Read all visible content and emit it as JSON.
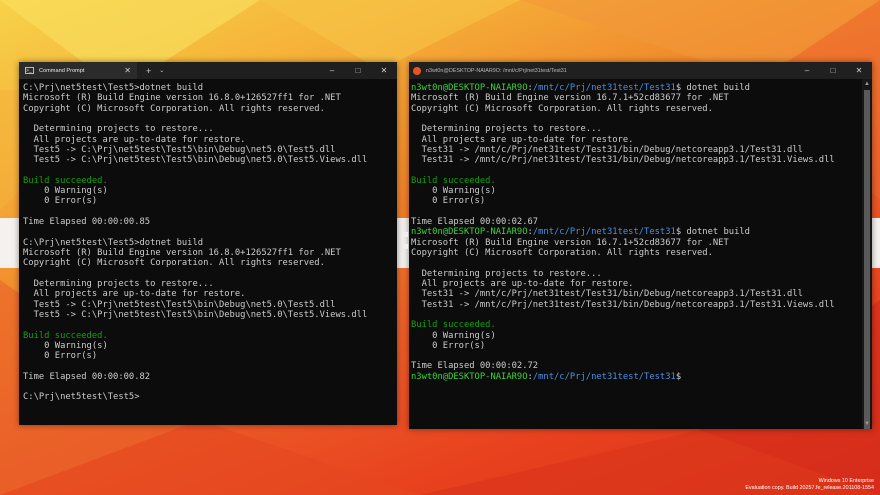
{
  "desktop": {
    "watermark": [
      "Windows 10 Enterprise",
      "Evaluation copy. Build 20257.fe_release.201108-1554"
    ]
  },
  "cmd_window": {
    "tab_title": "Command Prompt",
    "controls": [
      "–",
      "□",
      "✕"
    ],
    "lines": [
      [
        {
          "t": "C:\\Prj\\net5test\\Test5>dotnet build"
        }
      ],
      [
        {
          "t": "Microsoft (R) Build Engine version 16.8.0+126527ff1 for .NET"
        }
      ],
      [
        {
          "t": "Copyright (C) Microsoft Corporation. All rights reserved."
        }
      ],
      [
        {
          "t": ""
        }
      ],
      [
        {
          "t": "  Determining projects to restore..."
        }
      ],
      [
        {
          "t": "  All projects are up-to-date for restore."
        }
      ],
      [
        {
          "t": "  Test5 -> C:\\Prj\\net5test\\Test5\\bin\\Debug\\net5.0\\Test5.dll"
        }
      ],
      [
        {
          "t": "  Test5 -> C:\\Prj\\net5test\\Test5\\bin\\Debug\\net5.0\\Test5.Views.dll"
        }
      ],
      [
        {
          "t": ""
        }
      ],
      [
        {
          "t": "Build succeeded.",
          "c": "g"
        }
      ],
      [
        {
          "t": "    0 Warning(s)"
        }
      ],
      [
        {
          "t": "    0 Error(s)"
        }
      ],
      [
        {
          "t": ""
        }
      ],
      [
        {
          "t": "Time Elapsed 00:00:00.85"
        }
      ],
      [
        {
          "t": ""
        }
      ],
      [
        {
          "t": "C:\\Prj\\net5test\\Test5>dotnet build"
        }
      ],
      [
        {
          "t": "Microsoft (R) Build Engine version 16.8.0+126527ff1 for .NET"
        }
      ],
      [
        {
          "t": "Copyright (C) Microsoft Corporation. All rights reserved."
        }
      ],
      [
        {
          "t": ""
        }
      ],
      [
        {
          "t": "  Determining projects to restore..."
        }
      ],
      [
        {
          "t": "  All projects are up-to-date for restore."
        }
      ],
      [
        {
          "t": "  Test5 -> C:\\Prj\\net5test\\Test5\\bin\\Debug\\net5.0\\Test5.dll"
        }
      ],
      [
        {
          "t": "  Test5 -> C:\\Prj\\net5test\\Test5\\bin\\Debug\\net5.0\\Test5.Views.dll"
        }
      ],
      [
        {
          "t": ""
        }
      ],
      [
        {
          "t": "Build succeeded.",
          "c": "g"
        }
      ],
      [
        {
          "t": "    0 Warning(s)"
        }
      ],
      [
        {
          "t": "    0 Error(s)"
        }
      ],
      [
        {
          "t": ""
        }
      ],
      [
        {
          "t": "Time Elapsed 00:00:00.82"
        }
      ],
      [
        {
          "t": ""
        }
      ],
      [
        {
          "t": "C:\\Prj\\net5test\\Test5>"
        }
      ]
    ]
  },
  "wsl_window": {
    "title": "n3wt0n@DESKTOP-NAIAR9O: /mnt/c/Prj/net31test/Test31",
    "controls": [
      "–",
      "□",
      "✕"
    ],
    "lines": [
      [
        {
          "t": "n3wt0n@DESKTOP-NAIAR9O",
          "c": "bg"
        },
        {
          "t": ":"
        },
        {
          "t": "/mnt/c/Prj/net31test/Test31",
          "c": "bl"
        },
        {
          "t": "$ dotnet build"
        }
      ],
      [
        {
          "t": "Microsoft (R) Build Engine version 16.7.1+52cd83677 for .NET"
        }
      ],
      [
        {
          "t": "Copyright (C) Microsoft Corporation. All rights reserved."
        }
      ],
      [
        {
          "t": ""
        }
      ],
      [
        {
          "t": "  Determining projects to restore..."
        }
      ],
      [
        {
          "t": "  All projects are up-to-date for restore."
        }
      ],
      [
        {
          "t": "  Test31 -> /mnt/c/Prj/net31test/Test31/bin/Debug/netcoreapp3.1/Test31.dll"
        }
      ],
      [
        {
          "t": "  Test31 -> /mnt/c/Prj/net31test/Test31/bin/Debug/netcoreapp3.1/Test31.Views.dll"
        }
      ],
      [
        {
          "t": ""
        }
      ],
      [
        {
          "t": "Build succeeded.",
          "c": "g"
        }
      ],
      [
        {
          "t": "    0 Warning(s)"
        }
      ],
      [
        {
          "t": "    0 Error(s)"
        }
      ],
      [
        {
          "t": ""
        }
      ],
      [
        {
          "t": "Time Elapsed 00:00:02.67"
        }
      ],
      [
        {
          "t": "n3wt0n@DESKTOP-NAIAR9O",
          "c": "bg"
        },
        {
          "t": ":"
        },
        {
          "t": "/mnt/c/Prj/net31test/Test31",
          "c": "bl"
        },
        {
          "t": "$ dotnet build"
        }
      ],
      [
        {
          "t": "Microsoft (R) Build Engine version 16.7.1+52cd83677 for .NET"
        }
      ],
      [
        {
          "t": "Copyright (C) Microsoft Corporation. All rights reserved."
        }
      ],
      [
        {
          "t": ""
        }
      ],
      [
        {
          "t": "  Determining projects to restore..."
        }
      ],
      [
        {
          "t": "  All projects are up-to-date for restore."
        }
      ],
      [
        {
          "t": "  Test31 -> /mnt/c/Prj/net31test/Test31/bin/Debug/netcoreapp3.1/Test31.dll"
        }
      ],
      [
        {
          "t": "  Test31 -> /mnt/c/Prj/net31test/Test31/bin/Debug/netcoreapp3.1/Test31.Views.dll"
        }
      ],
      [
        {
          "t": ""
        }
      ],
      [
        {
          "t": "Build succeeded.",
          "c": "g"
        }
      ],
      [
        {
          "t": "    0 Warning(s)"
        }
      ],
      [
        {
          "t": "    0 Error(s)"
        }
      ],
      [
        {
          "t": ""
        }
      ],
      [
        {
          "t": "Time Elapsed 00:00:02.72"
        }
      ],
      [
        {
          "t": "n3wt0n@DESKTOP-NAIAR9O",
          "c": "bg"
        },
        {
          "t": ":"
        },
        {
          "t": "/mnt/c/Prj/net31test/Test31",
          "c": "bl"
        },
        {
          "t": "$"
        }
      ]
    ]
  }
}
